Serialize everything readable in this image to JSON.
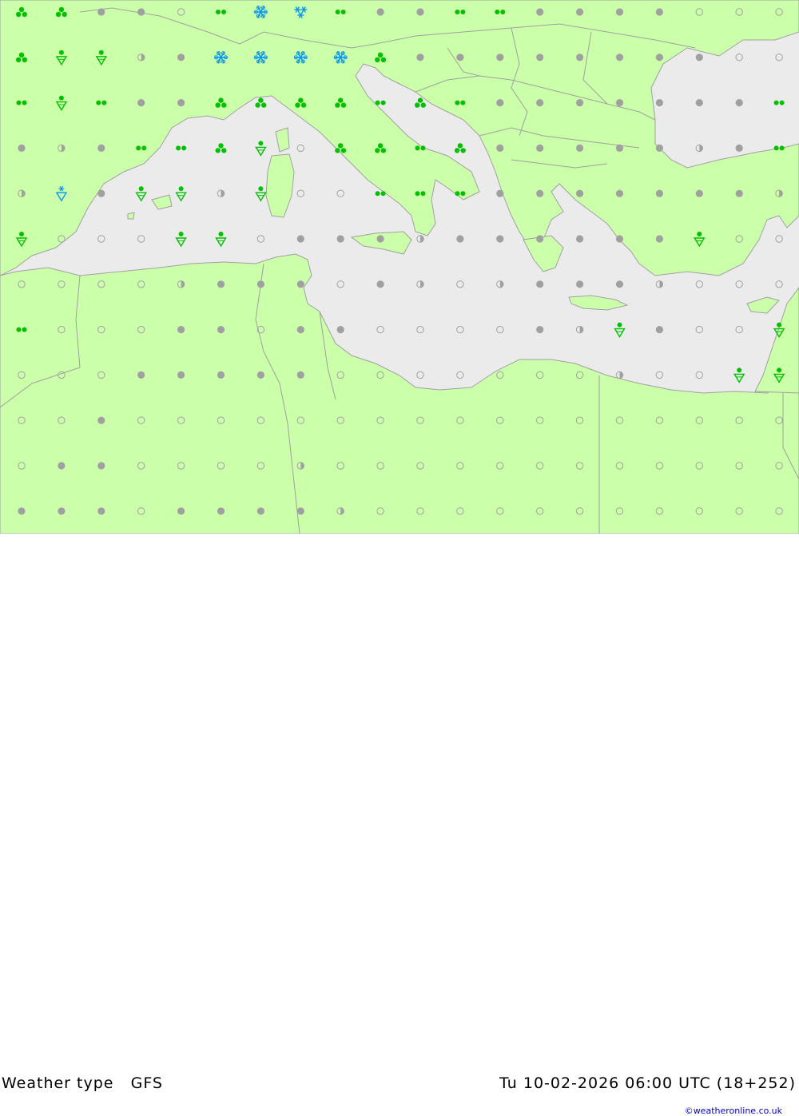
{
  "footer": {
    "title": "Weather type   GFS",
    "datetime": "Tu 10-02-2026 06:00 UTC (18+252)",
    "credit": "©weatheronline.co.uk"
  },
  "colors": {
    "sea": "#ebebeb",
    "land": "#ccffaa",
    "border": "#a0a0a0",
    "rain": "#00c000",
    "snow": "#0096ff",
    "cloud": "#a0a0a0"
  },
  "legend_symbols": [
    "clear",
    "partly-cloudy",
    "overcast",
    "drizzle",
    "rain",
    "shower",
    "snow",
    "snow-shower"
  ],
  "grid": {
    "columns": 20,
    "rows": 12,
    "symbols": [
      [
        "rain",
        "rain",
        "overcast",
        "overcast",
        "clear",
        "drizzle",
        "snow",
        "snow-shower",
        "drizzle",
        "overcast",
        "overcast",
        "drizzle",
        "drizzle",
        "overcast",
        "overcast",
        "overcast",
        "overcast",
        "clear",
        "clear",
        "clear"
      ],
      [
        "rain",
        "shower",
        "shower",
        "partly-cloudy",
        "overcast",
        "snow",
        "snow",
        "snow",
        "snow",
        "rain",
        "overcast",
        "overcast",
        "overcast",
        "overcast",
        "overcast",
        "overcast",
        "overcast",
        "overcast",
        "clear",
        "clear"
      ],
      [
        "drizzle",
        "shower",
        "drizzle",
        "overcast",
        "overcast",
        "rain",
        "rain",
        "rain",
        "rain",
        "drizzle",
        "rain",
        "drizzle",
        "overcast",
        "overcast",
        "overcast",
        "overcast",
        "overcast",
        "overcast",
        "overcast",
        "drizzle"
      ],
      [
        "overcast",
        "partly-cloudy",
        "overcast",
        "drizzle",
        "drizzle",
        "rain",
        "shower",
        "clear",
        "rain",
        "rain",
        "drizzle",
        "rain",
        "overcast",
        "overcast",
        "overcast",
        "overcast",
        "overcast",
        "partly-cloudy",
        "overcast",
        "drizzle"
      ],
      [
        "partly-cloudy",
        "snow-shower",
        "overcast",
        "shower",
        "shower",
        "partly-cloudy",
        "shower",
        "clear",
        "clear",
        "drizzle",
        "drizzle",
        "drizzle",
        "overcast",
        "overcast",
        "overcast",
        "overcast",
        "overcast",
        "overcast",
        "overcast",
        "partly-cloudy"
      ],
      [
        "shower",
        "clear",
        "clear",
        "clear",
        "shower",
        "shower",
        "clear",
        "overcast",
        "overcast",
        "overcast",
        "partly-cloudy",
        "overcast",
        "overcast",
        "overcast",
        "overcast",
        "overcast",
        "overcast",
        "shower",
        "clear",
        "clear"
      ],
      [
        "clear",
        "clear",
        "clear",
        "clear",
        "partly-cloudy",
        "overcast",
        "overcast",
        "overcast",
        "clear",
        "overcast",
        "partly-cloudy",
        "clear",
        "partly-cloudy",
        "overcast",
        "overcast",
        "overcast",
        "partly-cloudy",
        "clear",
        "clear",
        "clear"
      ],
      [
        "drizzle",
        "clear",
        "clear",
        "clear",
        "overcast",
        "overcast",
        "clear",
        "overcast",
        "overcast",
        "clear",
        "clear",
        "clear",
        "clear",
        "overcast",
        "partly-cloudy",
        "shower",
        "overcast",
        "clear",
        "clear",
        "shower"
      ],
      [
        "clear",
        "clear",
        "clear",
        "overcast",
        "overcast",
        "overcast",
        "overcast",
        "overcast",
        "clear",
        "clear",
        "clear",
        "clear",
        "clear",
        "clear",
        "clear",
        "partly-cloudy",
        "clear",
        "clear",
        "shower",
        "shower"
      ],
      [
        "clear",
        "clear",
        "overcast",
        "clear",
        "clear",
        "clear",
        "clear",
        "clear",
        "clear",
        "clear",
        "clear",
        "clear",
        "clear",
        "clear",
        "clear",
        "clear",
        "clear",
        "clear",
        "clear",
        "clear"
      ],
      [
        "clear",
        "overcast",
        "overcast",
        "clear",
        "clear",
        "clear",
        "clear",
        "partly-cloudy",
        "clear",
        "clear",
        "clear",
        "clear",
        "clear",
        "clear",
        "clear",
        "clear",
        "clear",
        "clear",
        "clear",
        "clear"
      ],
      [
        "overcast",
        "overcast",
        "overcast",
        "clear",
        "overcast",
        "overcast",
        "overcast",
        "overcast",
        "partly-cloudy",
        "clear",
        "clear",
        "clear",
        "clear",
        "clear",
        "clear",
        "clear",
        "clear",
        "clear",
        "clear",
        "clear"
      ]
    ]
  }
}
